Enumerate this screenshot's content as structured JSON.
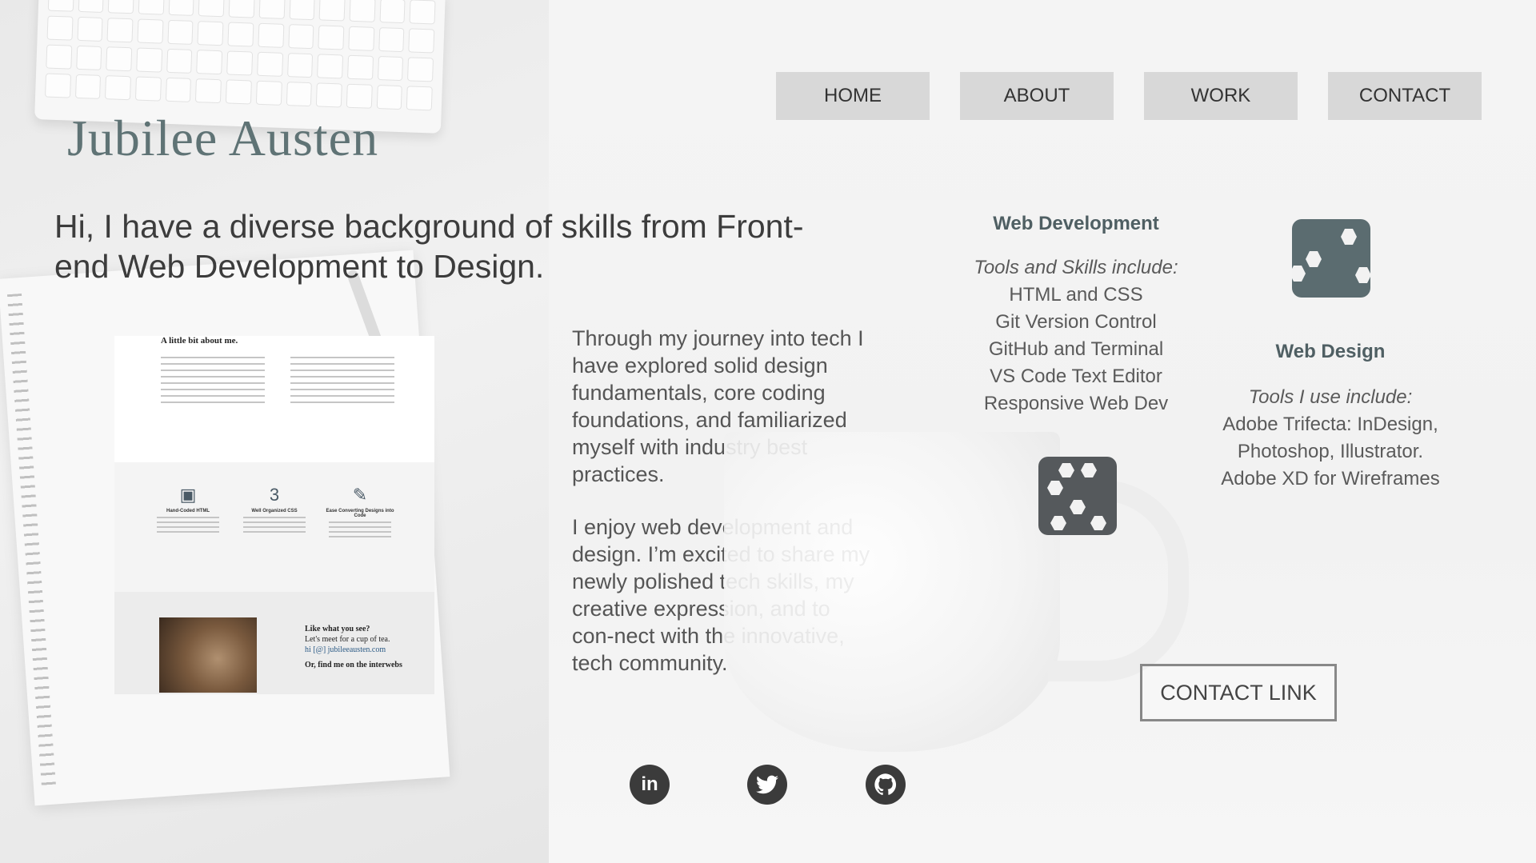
{
  "brand": {
    "name": "Jubilee Austen"
  },
  "nav": [
    {
      "label": "HOME"
    },
    {
      "label": "ABOUT"
    },
    {
      "label": "WORK"
    },
    {
      "label": "CONTACT"
    }
  ],
  "headline": "Hi, I have a diverse background of skills from Front-end Web Development to Design.",
  "preview": {
    "title": "A little bit about me.",
    "cards": [
      {
        "title": "Hand-Coded HTML",
        "icon": "html-file-icon"
      },
      {
        "title": "Well Organized CSS",
        "icon": "css3-icon"
      },
      {
        "title": "Ease Converting Designs into Code",
        "icon": "pencil-icon"
      }
    ],
    "like_title": "Like what you see?",
    "like_sub": "Let's meet for a cup of tea.",
    "like_email": "hi [@] jubileeausten.com",
    "like_find": "Or, find me on the interwebs"
  },
  "body": {
    "para1": "Through my journey into tech I have explored solid design fundamentals, core coding foundations, and familiarized myself with industry best practices.",
    "para2": "I enjoy web development and design. I’m excited to share my newly polished tech skills, my creative expression, and to con-nect with the innovative, tech community."
  },
  "web_dev": {
    "title": "Web Development",
    "intro": "Tools and Skills include:",
    "items": [
      "HTML and CSS",
      "Git Version Control",
      "GitHub and Terminal",
      "VS Code Text Editor",
      "Responsive Web Dev"
    ]
  },
  "web_design": {
    "title": "Web Design",
    "intro": "Tools I use include:",
    "items": [
      "Adobe Trifecta: InDesign,",
      "Photoshop, Illustrator.",
      "Adobe XD for Wireframes"
    ]
  },
  "contact_link": "CONTACT LINK",
  "social": [
    {
      "icon": "linkedin-icon"
    },
    {
      "icon": "twitter-icon"
    },
    {
      "icon": "github-icon"
    }
  ],
  "colors": {
    "accent": "#5f7375",
    "hex_teal": "#5b6c70",
    "hex_dark": "#55595c",
    "nav_bg": "#d8d8d8"
  }
}
